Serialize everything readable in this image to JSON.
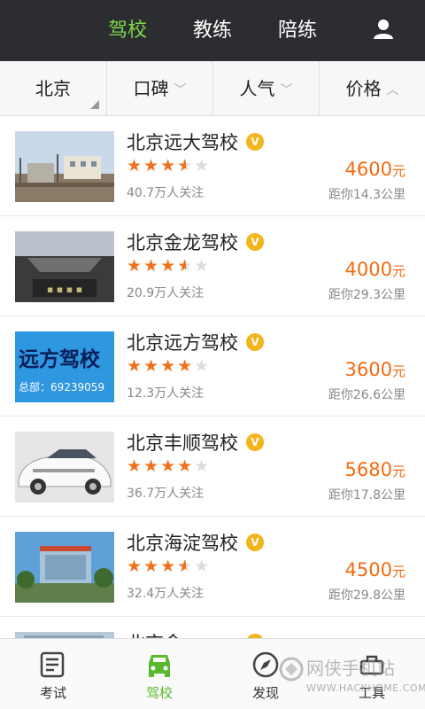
{
  "top_tabs": [
    {
      "label": "驾校",
      "active": true
    },
    {
      "label": "教练",
      "active": false
    },
    {
      "label": "陪练",
      "active": false
    }
  ],
  "user_icon": "user-icon",
  "filters": {
    "city": "北京",
    "reputation": "口碑",
    "popularity": "人气",
    "price": "价格"
  },
  "schools": [
    {
      "name": "北京远大驾校",
      "rating": 3.5,
      "stars": "★★★★",
      "follow": "40.7万人关注",
      "price": "4600",
      "unit": "元",
      "distance": "距你14.3公里"
    },
    {
      "name": "北京金龙驾校",
      "rating": 3.5,
      "stars": "★★★★",
      "follow": "20.9万人关注",
      "price": "4000",
      "unit": "元",
      "distance": "距你29.3公里"
    },
    {
      "name": "北京远方驾校",
      "rating": 4,
      "stars": "★★★★",
      "follow": "12.3万人关注",
      "price": "3600",
      "unit": "元",
      "distance": "距你26.6公里",
      "thumb_text": "远方驾校",
      "thumb_phone": "总部：69239059"
    },
    {
      "name": "北京丰顺驾校",
      "rating": 4,
      "stars": "★★★★",
      "follow": "36.7万人关注",
      "price": "5680",
      "unit": "元",
      "distance": "距你17.8公里"
    },
    {
      "name": "北京海淀驾校",
      "rating": 3.5,
      "stars": "★★★★",
      "follow": "32.4万人关注",
      "price": "4500",
      "unit": "元",
      "distance": "距你29.8公里"
    }
  ],
  "partial_row_name": "北京金",
  "bottom_nav": [
    {
      "label": "考试",
      "icon": "exam-icon",
      "active": false
    },
    {
      "label": "驾校",
      "icon": "car-icon",
      "active": true
    },
    {
      "label": "发现",
      "icon": "compass-icon",
      "active": false
    },
    {
      "label": "工具",
      "icon": "tools-icon",
      "active": false
    }
  ],
  "watermark": {
    "text": "网侠手机站",
    "url": "WWW.HACKHOME.COM"
  },
  "colors": {
    "active_green": "#7ed84a",
    "price_orange": "#f26a10",
    "star_orange": "#f0711c",
    "badge_gold": "#f2b51c"
  }
}
